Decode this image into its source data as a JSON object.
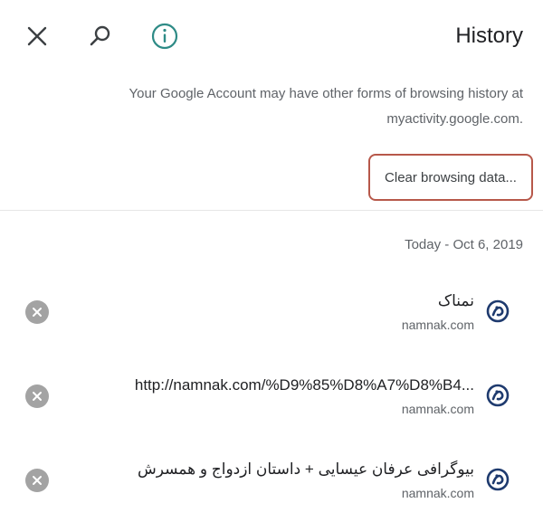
{
  "header": {
    "title": "History",
    "close_icon": "close-icon",
    "search_icon": "search-icon",
    "info_icon": "info-icon"
  },
  "notice": {
    "text": "Your Google Account may have other forms of browsing history at",
    "link": "myactivity.google.com."
  },
  "clear_button": {
    "label": "Clear browsing data..."
  },
  "date_header": "Today - Oct 6, 2019",
  "history": [
    {
      "title": "نمناک",
      "domain": "namnak.com",
      "favicon": "namnak-favicon"
    },
    {
      "title": "http://namnak.com/%D9%85%D8%A7%D8%B4...",
      "domain": "namnak.com",
      "favicon": "namnak-favicon"
    },
    {
      "title": "بیوگرافی عرفان عیسایی + داستان ازدواج و همسرش",
      "domain": "namnak.com",
      "favicon": "namnak-favicon"
    }
  ],
  "colors": {
    "accent_border": "#b7584a",
    "favicon_blue": "#1e3a6e",
    "remove_gray": "#a3a3a3",
    "info_teal": "#2e8b86"
  }
}
